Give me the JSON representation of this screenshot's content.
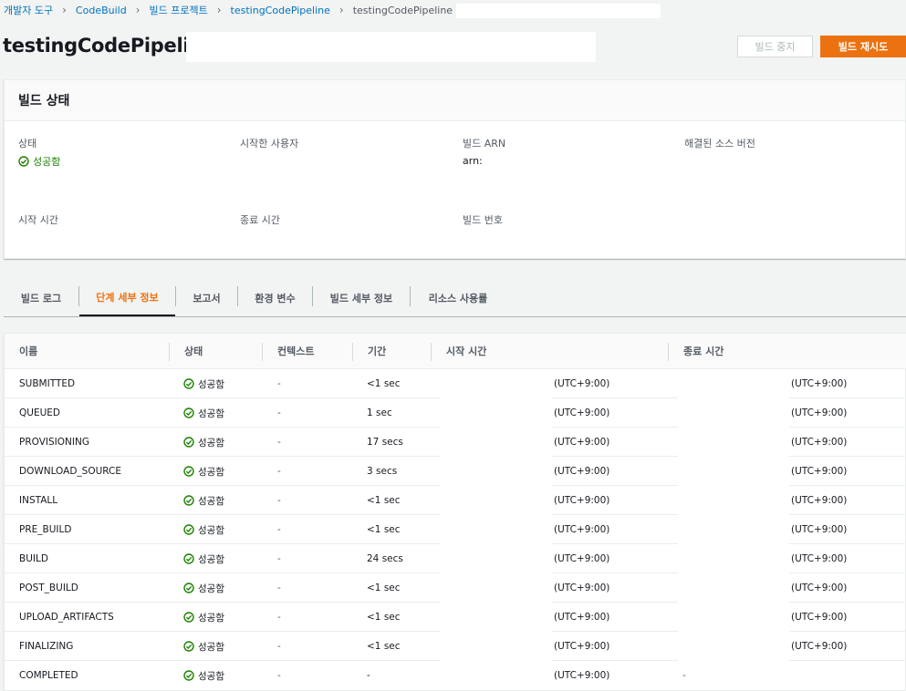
{
  "breadcrumb": {
    "items": [
      "개발자 도구",
      "CodeBuild",
      "빌드 프로젝트",
      "testingCodePipeline"
    ],
    "current": "testingCodePipeline"
  },
  "header": {
    "title": "testingCodePipeline",
    "stop_label": "빌드 중지",
    "retry_label": "빌드 재시도"
  },
  "build_status": {
    "title": "빌드 상태",
    "status_label": "상태",
    "status_value": "성공함",
    "initiator_label": "시작한 사용자",
    "arn_label": "빌드 ARN",
    "arn_value": "arn:",
    "source_version_label": "해결된 소스 버전",
    "start_time_label": "시작 시간",
    "end_time_label": "종료 시간",
    "build_number_label": "빌드 번호"
  },
  "tabs": [
    "빌드 로그",
    "단계 세부 정보",
    "보고서",
    "환경 변수",
    "빌드 세부 정보",
    "리소스 사용률"
  ],
  "active_tab": "단계 세부 정보",
  "table": {
    "headers": [
      "이름",
      "상태",
      "컨텍스트",
      "기간",
      "시작 시간",
      "종료 시간"
    ],
    "rows": [
      {
        "name": "SUBMITTED",
        "status": "성공함",
        "context": "-",
        "duration": "<1 sec",
        "start": "(UTC+9:00)",
        "end": "(UTC+9:00)"
      },
      {
        "name": "QUEUED",
        "status": "성공함",
        "context": "-",
        "duration": "1 sec",
        "start": "(UTC+9:00)",
        "end": "(UTC+9:00)"
      },
      {
        "name": "PROVISIONING",
        "status": "성공함",
        "context": "-",
        "duration": "17 secs",
        "start": "(UTC+9:00)",
        "end": "(UTC+9:00)"
      },
      {
        "name": "DOWNLOAD_SOURCE",
        "status": "성공함",
        "context": "-",
        "duration": "3 secs",
        "start": "(UTC+9:00)",
        "end": "(UTC+9:00)"
      },
      {
        "name": "INSTALL",
        "status": "성공함",
        "context": "-",
        "duration": "<1 sec",
        "start": "(UTC+9:00)",
        "end": "(UTC+9:00)"
      },
      {
        "name": "PRE_BUILD",
        "status": "성공함",
        "context": "-",
        "duration": "<1 sec",
        "start": "(UTC+9:00)",
        "end": "(UTC+9:00)"
      },
      {
        "name": "BUILD",
        "status": "성공함",
        "context": "-",
        "duration": "24 secs",
        "start": "(UTC+9:00)",
        "end": "(UTC+9:00)"
      },
      {
        "name": "POST_BUILD",
        "status": "성공함",
        "context": "-",
        "duration": "<1 sec",
        "start": "(UTC+9:00)",
        "end": "(UTC+9:00)"
      },
      {
        "name": "UPLOAD_ARTIFACTS",
        "status": "성공함",
        "context": "-",
        "duration": "<1 sec",
        "start": "(UTC+9:00)",
        "end": "(UTC+9:00)"
      },
      {
        "name": "FINALIZING",
        "status": "성공함",
        "context": "-",
        "duration": "<1 sec",
        "start": "(UTC+9:00)",
        "end": "(UTC+9:00)"
      },
      {
        "name": "COMPLETED",
        "status": "성공함",
        "context": "-",
        "duration": "-",
        "start": "(UTC+9:00)",
        "end": "-"
      }
    ]
  },
  "colors": {
    "accent": "#ec7211",
    "link": "#0073bb",
    "success": "#1d8102"
  },
  "icons": {
    "status_success": "check-circle-icon",
    "breadcrumb_separator": "chevron-right-icon"
  }
}
